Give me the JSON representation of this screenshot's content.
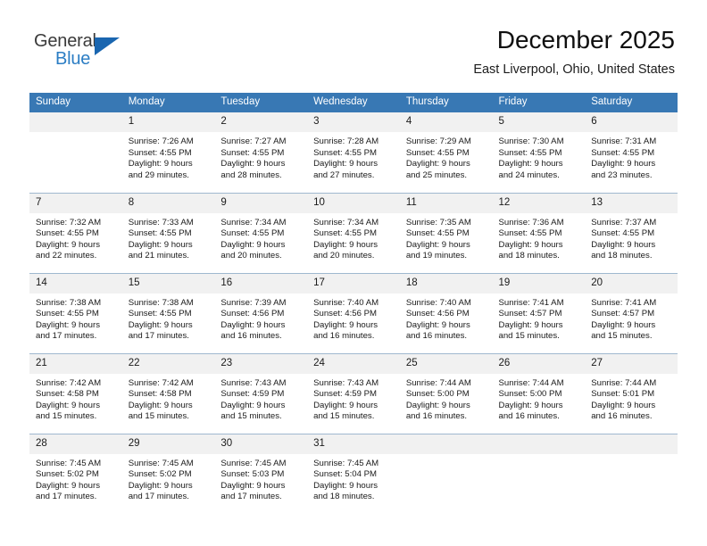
{
  "logo": {
    "word1": "General",
    "word2": "Blue",
    "triangle_color": "#1a66b0",
    "blue_color": "#2b7dc4"
  },
  "header": {
    "title": "December 2025",
    "location": "East Liverpool, Ohio, United States"
  },
  "theme": {
    "header_blue": "#3878b4",
    "daynum_gray": "#f1f1f1",
    "rule_blue": "#2f6fac"
  },
  "calendar": {
    "weekday_headers": [
      "Sunday",
      "Monday",
      "Tuesday",
      "Wednesday",
      "Thursday",
      "Friday",
      "Saturday"
    ],
    "weeks": [
      [
        {
          "day": "",
          "sunrise": "",
          "sunset": "",
          "daylight1": "",
          "daylight2": ""
        },
        {
          "day": "1",
          "sunrise": "Sunrise: 7:26 AM",
          "sunset": "Sunset: 4:55 PM",
          "daylight1": "Daylight: 9 hours",
          "daylight2": "and 29 minutes."
        },
        {
          "day": "2",
          "sunrise": "Sunrise: 7:27 AM",
          "sunset": "Sunset: 4:55 PM",
          "daylight1": "Daylight: 9 hours",
          "daylight2": "and 28 minutes."
        },
        {
          "day": "3",
          "sunrise": "Sunrise: 7:28 AM",
          "sunset": "Sunset: 4:55 PM",
          "daylight1": "Daylight: 9 hours",
          "daylight2": "and 27 minutes."
        },
        {
          "day": "4",
          "sunrise": "Sunrise: 7:29 AM",
          "sunset": "Sunset: 4:55 PM",
          "daylight1": "Daylight: 9 hours",
          "daylight2": "and 25 minutes."
        },
        {
          "day": "5",
          "sunrise": "Sunrise: 7:30 AM",
          "sunset": "Sunset: 4:55 PM",
          "daylight1": "Daylight: 9 hours",
          "daylight2": "and 24 minutes."
        },
        {
          "day": "6",
          "sunrise": "Sunrise: 7:31 AM",
          "sunset": "Sunset: 4:55 PM",
          "daylight1": "Daylight: 9 hours",
          "daylight2": "and 23 minutes."
        }
      ],
      [
        {
          "day": "7",
          "sunrise": "Sunrise: 7:32 AM",
          "sunset": "Sunset: 4:55 PM",
          "daylight1": "Daylight: 9 hours",
          "daylight2": "and 22 minutes."
        },
        {
          "day": "8",
          "sunrise": "Sunrise: 7:33 AM",
          "sunset": "Sunset: 4:55 PM",
          "daylight1": "Daylight: 9 hours",
          "daylight2": "and 21 minutes."
        },
        {
          "day": "9",
          "sunrise": "Sunrise: 7:34 AM",
          "sunset": "Sunset: 4:55 PM",
          "daylight1": "Daylight: 9 hours",
          "daylight2": "and 20 minutes."
        },
        {
          "day": "10",
          "sunrise": "Sunrise: 7:34 AM",
          "sunset": "Sunset: 4:55 PM",
          "daylight1": "Daylight: 9 hours",
          "daylight2": "and 20 minutes."
        },
        {
          "day": "11",
          "sunrise": "Sunrise: 7:35 AM",
          "sunset": "Sunset: 4:55 PM",
          "daylight1": "Daylight: 9 hours",
          "daylight2": "and 19 minutes."
        },
        {
          "day": "12",
          "sunrise": "Sunrise: 7:36 AM",
          "sunset": "Sunset: 4:55 PM",
          "daylight1": "Daylight: 9 hours",
          "daylight2": "and 18 minutes."
        },
        {
          "day": "13",
          "sunrise": "Sunrise: 7:37 AM",
          "sunset": "Sunset: 4:55 PM",
          "daylight1": "Daylight: 9 hours",
          "daylight2": "and 18 minutes."
        }
      ],
      [
        {
          "day": "14",
          "sunrise": "Sunrise: 7:38 AM",
          "sunset": "Sunset: 4:55 PM",
          "daylight1": "Daylight: 9 hours",
          "daylight2": "and 17 minutes."
        },
        {
          "day": "15",
          "sunrise": "Sunrise: 7:38 AM",
          "sunset": "Sunset: 4:55 PM",
          "daylight1": "Daylight: 9 hours",
          "daylight2": "and 17 minutes."
        },
        {
          "day": "16",
          "sunrise": "Sunrise: 7:39 AM",
          "sunset": "Sunset: 4:56 PM",
          "daylight1": "Daylight: 9 hours",
          "daylight2": "and 16 minutes."
        },
        {
          "day": "17",
          "sunrise": "Sunrise: 7:40 AM",
          "sunset": "Sunset: 4:56 PM",
          "daylight1": "Daylight: 9 hours",
          "daylight2": "and 16 minutes."
        },
        {
          "day": "18",
          "sunrise": "Sunrise: 7:40 AM",
          "sunset": "Sunset: 4:56 PM",
          "daylight1": "Daylight: 9 hours",
          "daylight2": "and 16 minutes."
        },
        {
          "day": "19",
          "sunrise": "Sunrise: 7:41 AM",
          "sunset": "Sunset: 4:57 PM",
          "daylight1": "Daylight: 9 hours",
          "daylight2": "and 15 minutes."
        },
        {
          "day": "20",
          "sunrise": "Sunrise: 7:41 AM",
          "sunset": "Sunset: 4:57 PM",
          "daylight1": "Daylight: 9 hours",
          "daylight2": "and 15 minutes."
        }
      ],
      [
        {
          "day": "21",
          "sunrise": "Sunrise: 7:42 AM",
          "sunset": "Sunset: 4:58 PM",
          "daylight1": "Daylight: 9 hours",
          "daylight2": "and 15 minutes."
        },
        {
          "day": "22",
          "sunrise": "Sunrise: 7:42 AM",
          "sunset": "Sunset: 4:58 PM",
          "daylight1": "Daylight: 9 hours",
          "daylight2": "and 15 minutes."
        },
        {
          "day": "23",
          "sunrise": "Sunrise: 7:43 AM",
          "sunset": "Sunset: 4:59 PM",
          "daylight1": "Daylight: 9 hours",
          "daylight2": "and 15 minutes."
        },
        {
          "day": "24",
          "sunrise": "Sunrise: 7:43 AM",
          "sunset": "Sunset: 4:59 PM",
          "daylight1": "Daylight: 9 hours",
          "daylight2": "and 15 minutes."
        },
        {
          "day": "25",
          "sunrise": "Sunrise: 7:44 AM",
          "sunset": "Sunset: 5:00 PM",
          "daylight1": "Daylight: 9 hours",
          "daylight2": "and 16 minutes."
        },
        {
          "day": "26",
          "sunrise": "Sunrise: 7:44 AM",
          "sunset": "Sunset: 5:00 PM",
          "daylight1": "Daylight: 9 hours",
          "daylight2": "and 16 minutes."
        },
        {
          "day": "27",
          "sunrise": "Sunrise: 7:44 AM",
          "sunset": "Sunset: 5:01 PM",
          "daylight1": "Daylight: 9 hours",
          "daylight2": "and 16 minutes."
        }
      ],
      [
        {
          "day": "28",
          "sunrise": "Sunrise: 7:45 AM",
          "sunset": "Sunset: 5:02 PM",
          "daylight1": "Daylight: 9 hours",
          "daylight2": "and 17 minutes."
        },
        {
          "day": "29",
          "sunrise": "Sunrise: 7:45 AM",
          "sunset": "Sunset: 5:02 PM",
          "daylight1": "Daylight: 9 hours",
          "daylight2": "and 17 minutes."
        },
        {
          "day": "30",
          "sunrise": "Sunrise: 7:45 AM",
          "sunset": "Sunset: 5:03 PM",
          "daylight1": "Daylight: 9 hours",
          "daylight2": "and 17 minutes."
        },
        {
          "day": "31",
          "sunrise": "Sunrise: 7:45 AM",
          "sunset": "Sunset: 5:04 PM",
          "daylight1": "Daylight: 9 hours",
          "daylight2": "and 18 minutes."
        },
        {
          "day": "",
          "sunrise": "",
          "sunset": "",
          "daylight1": "",
          "daylight2": ""
        },
        {
          "day": "",
          "sunrise": "",
          "sunset": "",
          "daylight1": "",
          "daylight2": ""
        },
        {
          "day": "",
          "sunrise": "",
          "sunset": "",
          "daylight1": "",
          "daylight2": ""
        }
      ]
    ]
  }
}
